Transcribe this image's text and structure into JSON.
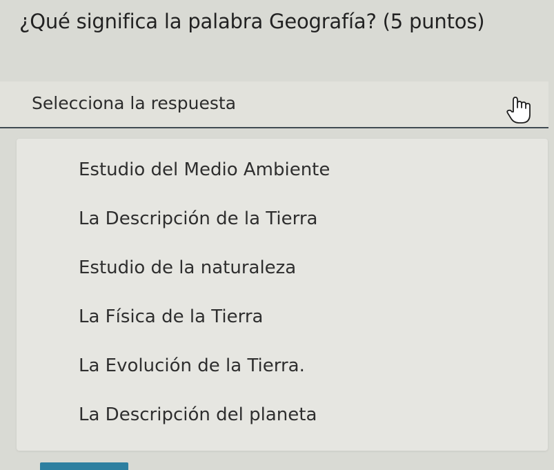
{
  "question": {
    "text": "¿Qué significa la palabra Geografía? (5 puntos)"
  },
  "select": {
    "placeholder": "Selecciona la respuesta",
    "cursor_icon": "hand-pointer-icon"
  },
  "options": [
    {
      "label": "Estudio del Medio Ambiente"
    },
    {
      "label": "La Descripción de la Tierra"
    },
    {
      "label": "Estudio de la naturaleza"
    },
    {
      "label": "La Física de la Tierra"
    },
    {
      "label": "La Evolución de la Tierra."
    },
    {
      "label": "La Descripción del planeta"
    }
  ],
  "colors": {
    "accent": "#2d7fa0",
    "underline": "#3f4a52",
    "background": "#d9dad4"
  }
}
